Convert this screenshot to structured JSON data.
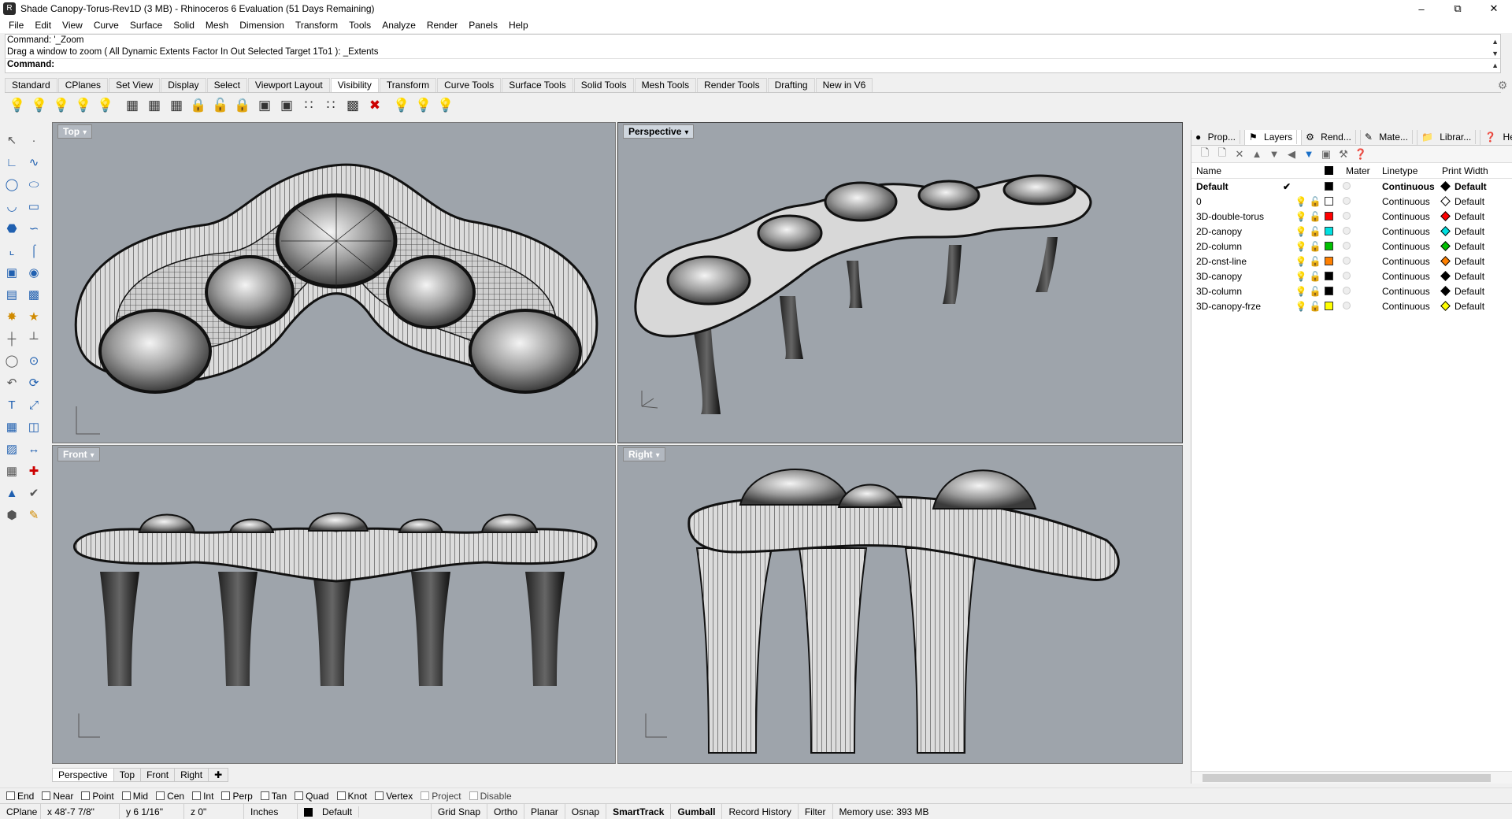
{
  "window": {
    "title": "Shade Canopy-Torus-Rev1D (3 MB) - Rhinoceros 6 Evaluation (51 Days Remaining)"
  },
  "menu": [
    "File",
    "Edit",
    "View",
    "Curve",
    "Surface",
    "Solid",
    "Mesh",
    "Dimension",
    "Transform",
    "Tools",
    "Analyze",
    "Render",
    "Panels",
    "Help"
  ],
  "command": {
    "line1": "Command: '_Zoom",
    "line2": "Drag a window to zoom ( All  Dynamic  Extents  Factor  In  Out  Selected  Target  1To1 ): _Extents",
    "prompt": "Command:"
  },
  "tabs": [
    "Standard",
    "CPlanes",
    "Set View",
    "Display",
    "Select",
    "Viewport Layout",
    "Visibility",
    "Transform",
    "Curve Tools",
    "Surface Tools",
    "Solid Tools",
    "Mesh Tools",
    "Render Tools",
    "Drafting",
    "New in V6"
  ],
  "active_tab": "Visibility",
  "viewports": {
    "top": "Top",
    "perspective": "Perspective",
    "front": "Front",
    "right": "Right"
  },
  "viewport_tabs": [
    "Perspective",
    "Top",
    "Front",
    "Right"
  ],
  "panel_tabs": [
    "Prop...",
    "Layers",
    "Rend...",
    "Mate...",
    "Librar...",
    "Help"
  ],
  "layers": {
    "headers": {
      "name": "Name",
      "material": "Mater",
      "linetype": "Linetype",
      "print_width": "Print Width"
    },
    "rows": [
      {
        "name": "Default",
        "color": "#000000",
        "linetype": "Continuous",
        "print_width": "Default",
        "current": true
      },
      {
        "name": "0",
        "color": "#ffffff",
        "linetype": "Continuous",
        "print_width": "Default"
      },
      {
        "name": "3D-double-torus",
        "color": "#ff0000",
        "linetype": "Continuous",
        "print_width": "Default"
      },
      {
        "name": "2D-canopy",
        "color": "#00e0e0",
        "linetype": "Continuous",
        "print_width": "Default"
      },
      {
        "name": "2D-column",
        "color": "#00c000",
        "linetype": "Continuous",
        "print_width": "Default"
      },
      {
        "name": "2D-cnst-line",
        "color": "#ff8000",
        "linetype": "Continuous",
        "print_width": "Default"
      },
      {
        "name": "3D-canopy",
        "color": "#000000",
        "linetype": "Continuous",
        "print_width": "Default"
      },
      {
        "name": "3D-column",
        "color": "#000000",
        "linetype": "Continuous",
        "print_width": "Default"
      },
      {
        "name": "3D-canopy-frze",
        "color": "#ffff00",
        "linetype": "Continuous",
        "print_width": "Default"
      }
    ]
  },
  "osnaps": [
    "End",
    "Near",
    "Point",
    "Mid",
    "Cen",
    "Int",
    "Perp",
    "Tan",
    "Quad",
    "Knot",
    "Vertex"
  ],
  "osnap_disabled": [
    "Project",
    "Disable"
  ],
  "status": {
    "cplane": "CPlane",
    "x": "x 48'-7 7/8\"",
    "y": "y 6 1/16\"",
    "z": "z 0\"",
    "units": "Inches",
    "layer": "Default",
    "toggles": [
      "Grid Snap",
      "Ortho",
      "Planar",
      "Osnap"
    ],
    "smarttrack": "SmartTrack",
    "gumball": "Gumball",
    "record": "Record History",
    "filter": "Filter",
    "memory": "Memory use: 393 MB"
  }
}
